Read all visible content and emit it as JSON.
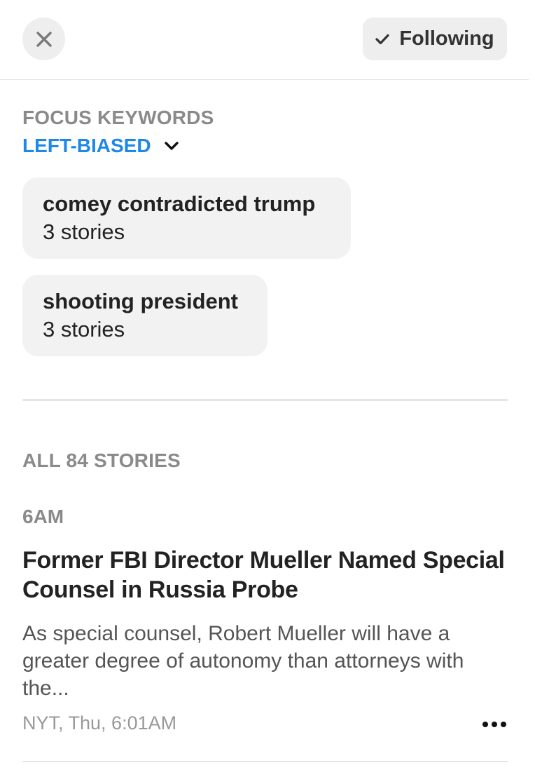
{
  "header": {
    "close_icon": "close-icon",
    "following_label": "Following",
    "following_icon": "checkmark-icon"
  },
  "focus": {
    "heading": "FOCUS KEYWORDS",
    "bias_label": "LEFT-BIASED",
    "bias_color": "#1e88e5",
    "chevron_icon": "chevron-down-icon",
    "keywords": [
      {
        "title": "comey contradicted trump",
        "count": "3 stories"
      },
      {
        "title": "shooting president",
        "count": "3 stories"
      }
    ]
  },
  "stories": {
    "heading": "ALL 84 STORIES",
    "items": [
      {
        "time": "6AM",
        "title": "Former FBI Director Mueller Named Special Counsel in Russia Probe",
        "description": "As special counsel, Robert Mueller will have a greater degree of autonomy than attorneys with the...",
        "meta": "NYT, Thu, 6:01AM",
        "more_icon": "more-options-icon"
      }
    ]
  }
}
